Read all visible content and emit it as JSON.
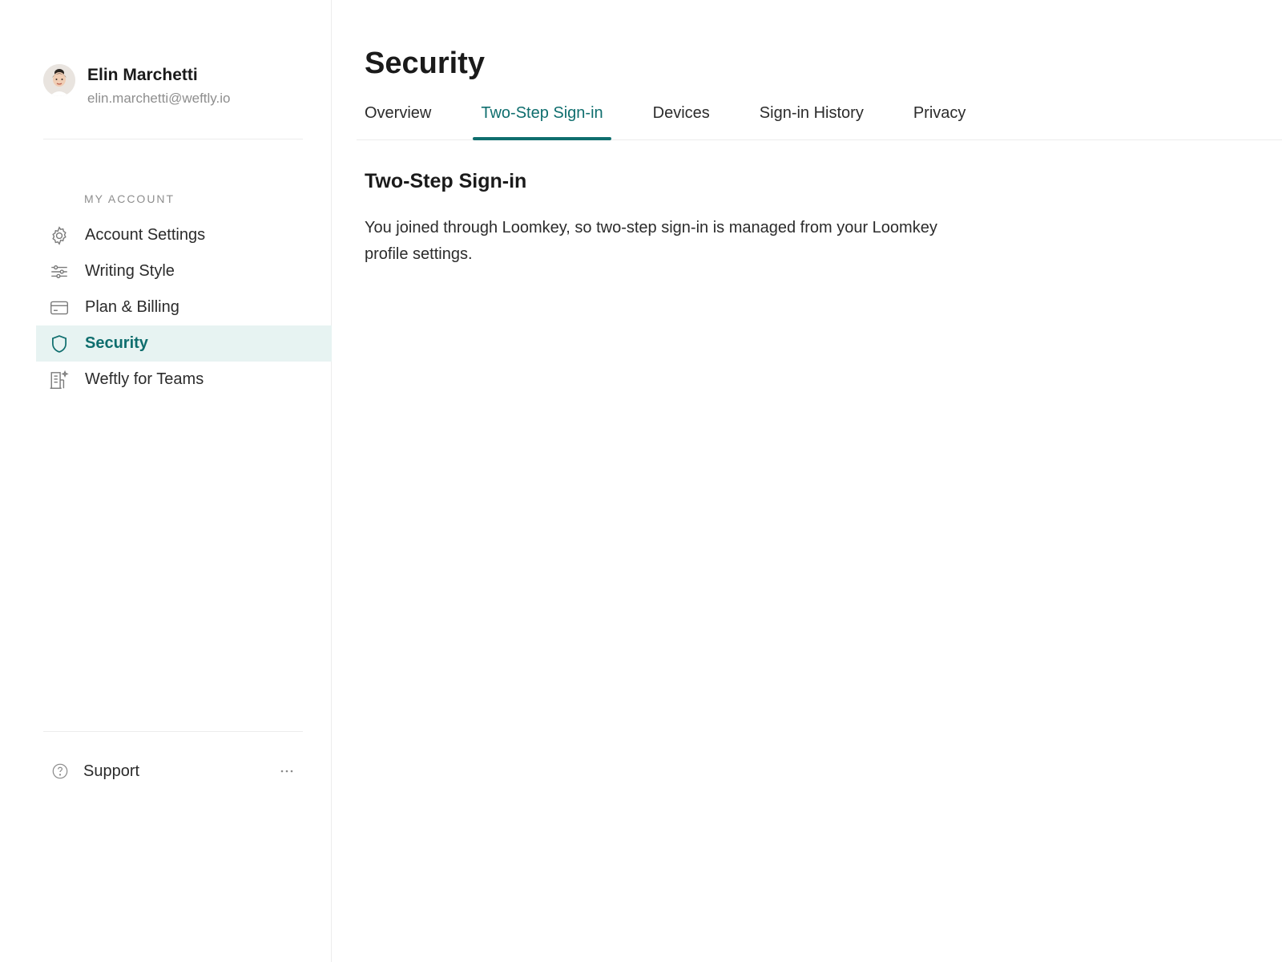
{
  "user": {
    "name": "Elin Marchetti",
    "email": "elin.marchetti@weftly.io"
  },
  "sidebar": {
    "section_label": "MY ACCOUNT",
    "items": [
      {
        "label": "Account Settings",
        "icon": "gear-icon",
        "active": false
      },
      {
        "label": "Writing Style",
        "icon": "sliders-icon",
        "active": false
      },
      {
        "label": "Plan & Billing",
        "icon": "credit-card-icon",
        "active": false
      },
      {
        "label": "Security",
        "icon": "shield-icon",
        "active": true
      },
      {
        "label": "Weftly for Teams",
        "icon": "building-sparkle-icon",
        "active": false
      }
    ],
    "support_label": "Support",
    "more_glyph": "···"
  },
  "main": {
    "title": "Security",
    "tabs": [
      {
        "label": "Overview",
        "active": false
      },
      {
        "label": "Two-Step Sign-in",
        "active": true
      },
      {
        "label": "Devices",
        "active": false
      },
      {
        "label": "Sign-in History",
        "active": false
      },
      {
        "label": "Privacy",
        "active": false
      }
    ],
    "section": {
      "heading": "Two-Step Sign-in",
      "body": "You joined through Loomkey, so two-step sign-in is managed from your Loomkey profile settings."
    }
  },
  "colors": {
    "accent": "#0f6e6e",
    "active_bg": "#e7f3f2",
    "muted_text": "#8e8e8e",
    "divider": "#ececec"
  }
}
